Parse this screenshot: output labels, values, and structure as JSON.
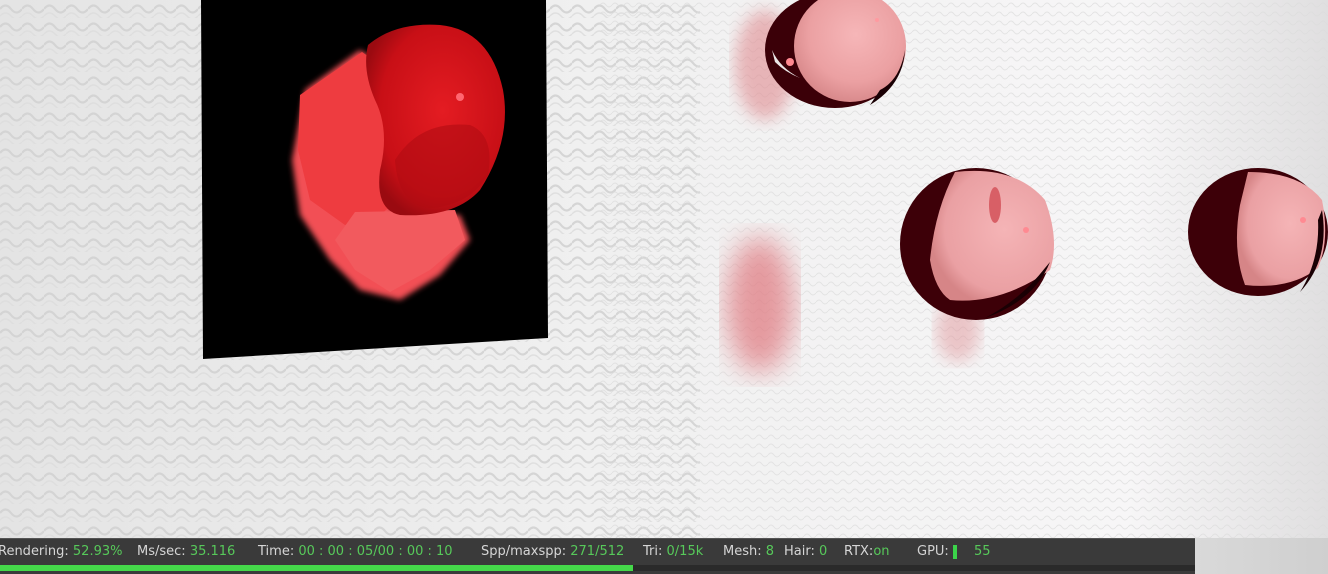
{
  "viewport": {
    "label": "render viewport",
    "colors": {
      "wall": "#f1f1f1",
      "panel": "#000000",
      "blob": "#d4151b",
      "sphere_pink": "#f2a7a9",
      "sphere_dark": "#3a0008"
    }
  },
  "status": {
    "rendering_label": "Rendering:",
    "rendering_value": "52.93%",
    "progress_fraction": 0.5293,
    "ms_label": "Ms/sec:",
    "ms_value": "35.116",
    "time_label": "Time:",
    "time_value": "00 : 00 : 05/00 : 00 : 10",
    "spp_label": "Spp/maxspp:",
    "spp_value": "271/512",
    "tri_label": "Tri:",
    "tri_value": "0/15k",
    "mesh_label": "Mesh:",
    "mesh_value": "8",
    "hair_label": "Hair:",
    "hair_value": "0",
    "rtx_label": "RTX:",
    "rtx_value": "on",
    "gpu_label": "GPU:",
    "gpu_value": "55",
    "accent_color": "#45d84a"
  }
}
